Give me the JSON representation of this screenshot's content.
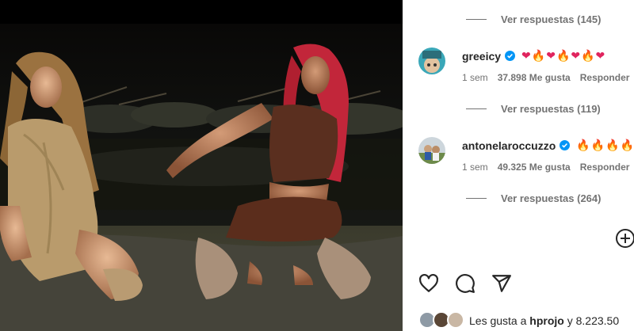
{
  "post": {
    "image_description_icon": "photo-icon"
  },
  "comments_panel": {
    "reply_threads": [
      {
        "label": "Ver respuestas (145)"
      },
      {
        "label": "Ver respuestas (119)"
      },
      {
        "label": "Ver respuestas (264)"
      }
    ],
    "comments": [
      {
        "username": "greeicy",
        "verified": true,
        "text": "❤🔥❤🔥❤🔥❤",
        "time": "1 sem",
        "likes": "37.898 Me gusta",
        "reply_label": "Responder"
      },
      {
        "username": "antonelaroccuzzo",
        "verified": true,
        "text": "🔥🔥🔥🔥",
        "time": "1 sem",
        "likes": "49.325 Me gusta",
        "reply_label": "Responder"
      }
    ],
    "add_icon": "add-circle-icon"
  },
  "actions": {
    "like_icon": "heart-icon",
    "comment_icon": "comment-icon",
    "share_icon": "send-icon"
  },
  "likes_summary": {
    "prefix": "Les gusta a",
    "user": "hprojo",
    "suffix": "y 8.223.50"
  },
  "colors": {
    "verified_blue": "#0095f6",
    "muted_text": "#737373",
    "primary_text": "#262626"
  }
}
